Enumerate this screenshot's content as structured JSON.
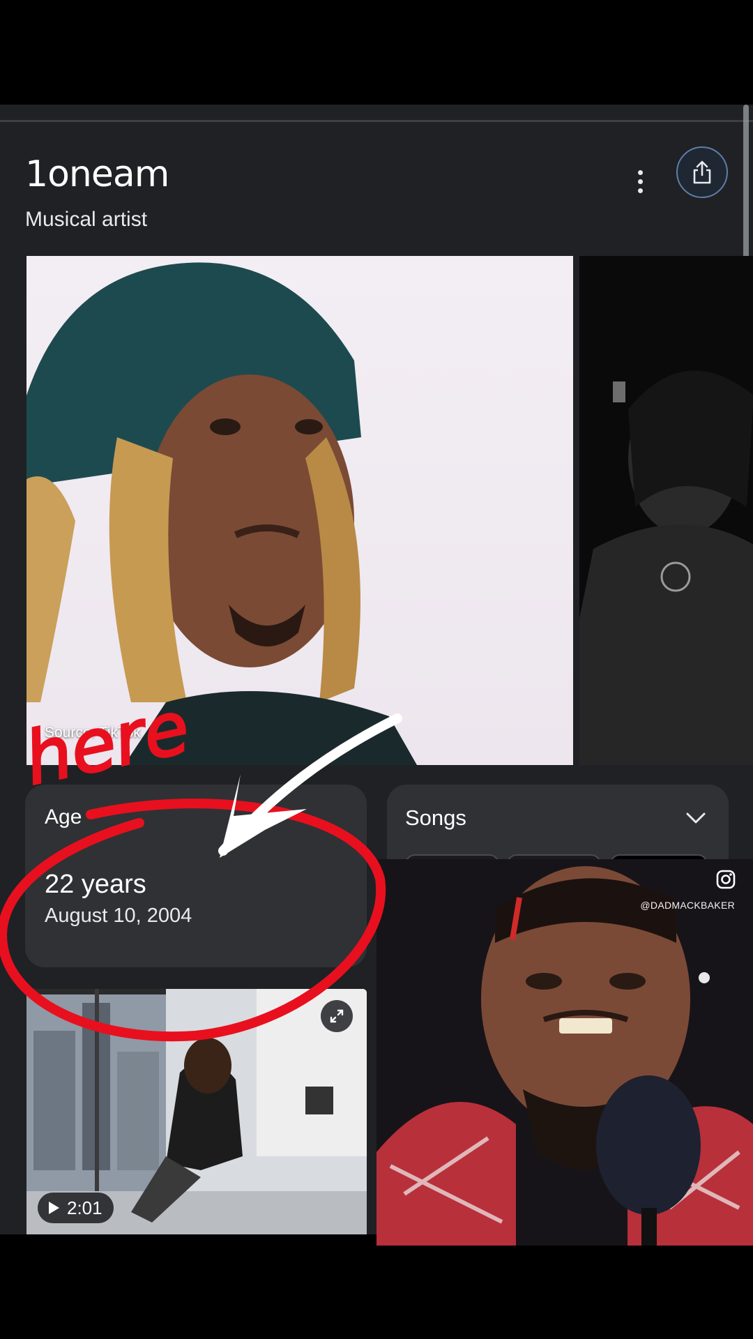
{
  "header": {
    "title": "1oneam",
    "subtitle": "Musical artist"
  },
  "gallery": {
    "source_label": "Source: TikTok"
  },
  "age_card": {
    "label": "Age",
    "value": "22 years",
    "date": "August 10, 2004"
  },
  "songs_card": {
    "label": "Songs"
  },
  "video": {
    "duration": "2:01"
  },
  "overlay_video": {
    "handle": "@DADMACKBAKER"
  },
  "annotation": {
    "text": "here",
    "color": "#e8101e"
  },
  "colors": {
    "panel_bg": "#202124",
    "card_bg": "#303134",
    "accent_border": "#5f7ea8"
  }
}
